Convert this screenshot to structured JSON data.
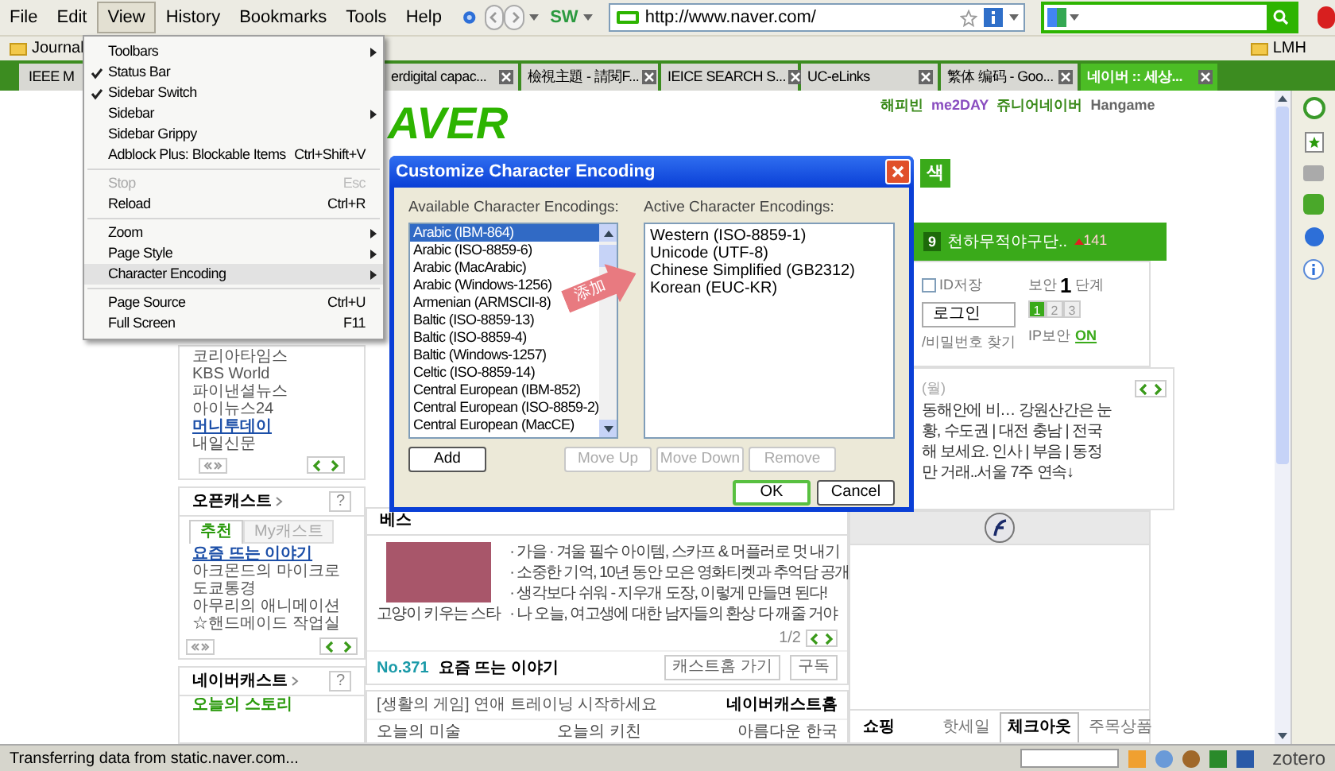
{
  "menu_bar": [
    {
      "label": "File",
      "selected": false
    },
    {
      "label": "Edit",
      "selected": false
    },
    {
      "label": "View",
      "selected": true
    },
    {
      "label": "History",
      "selected": false
    },
    {
      "label": "Bookmarks",
      "selected": false
    },
    {
      "label": "Tools",
      "selected": false
    },
    {
      "label": "Help",
      "selected": false
    }
  ],
  "navigation": {
    "search_engine": "SW",
    "url": "http://www.naver.com/"
  },
  "bookmarks_bar": [
    {
      "label": "Journal"
    },
    {
      "label": "LMH"
    }
  ],
  "tabs": [
    {
      "label": "IEEE M",
      "selected": false
    },
    {
      "label": "erdigital capac...",
      "selected": false
    },
    {
      "label": "檢視主題 - 請閱F...",
      "selected": false
    },
    {
      "label": "IEICE SEARCH S...",
      "selected": false
    },
    {
      "label": "UC-eLinks",
      "selected": false
    },
    {
      "label": "繁体 编码 - Goo...",
      "selected": false
    },
    {
      "label": "네이버 :: 세상...",
      "selected": true
    }
  ],
  "view_menu": [
    {
      "kind": "item",
      "label": "Toolbars",
      "submenu": true,
      "checked": false,
      "disabled": false,
      "selected": false
    },
    {
      "kind": "item",
      "label": "Status Bar",
      "submenu": false,
      "checked": true,
      "disabled": false,
      "selected": false
    },
    {
      "kind": "item",
      "label": "Sidebar Switch",
      "submenu": false,
      "checked": true,
      "disabled": false,
      "selected": false
    },
    {
      "kind": "item",
      "label": "Sidebar",
      "submenu": true,
      "checked": false,
      "disabled": false,
      "selected": false
    },
    {
      "kind": "item",
      "label": "Sidebar Grippy",
      "submenu": false,
      "checked": false,
      "disabled": false,
      "selected": false
    },
    {
      "kind": "item",
      "label": "Adblock Plus: Blockable Items",
      "shortcut": "Ctrl+Shift+V",
      "submenu": false,
      "checked": false,
      "disabled": false,
      "selected": false
    },
    {
      "kind": "separator"
    },
    {
      "kind": "item",
      "label": "Stop",
      "shortcut": "Esc",
      "submenu": false,
      "checked": false,
      "disabled": true,
      "selected": false
    },
    {
      "kind": "item",
      "label": "Reload",
      "shortcut": "Ctrl+R",
      "submenu": false,
      "checked": false,
      "disabled": false,
      "selected": false
    },
    {
      "kind": "separator"
    },
    {
      "kind": "item",
      "label": "Zoom",
      "submenu": true,
      "checked": false,
      "disabled": false,
      "selected": false
    },
    {
      "kind": "item",
      "label": "Page Style",
      "submenu": true,
      "checked": false,
      "disabled": false,
      "selected": false
    },
    {
      "kind": "item",
      "label": "Character Encoding",
      "submenu": true,
      "checked": false,
      "disabled": false,
      "selected": true
    },
    {
      "kind": "separator"
    },
    {
      "kind": "item",
      "label": "Page Source",
      "shortcut": "Ctrl+U",
      "submenu": false,
      "checked": false,
      "disabled": false,
      "selected": false
    },
    {
      "kind": "item",
      "label": "Full Screen",
      "shortcut": "F11",
      "submenu": false,
      "checked": false,
      "disabled": false,
      "selected": false
    }
  ],
  "dialog": {
    "title": "Customize Character Encoding",
    "available_label": "Available Character Encodings:",
    "available": [
      {
        "label": "Arabic (IBM-864)",
        "selected": true
      },
      {
        "label": "Arabic (ISO-8859-6)",
        "selected": false
      },
      {
        "label": "Arabic (MacArabic)",
        "selected": false
      },
      {
        "label": "Arabic (Windows-1256)",
        "selected": false
      },
      {
        "label": "Armenian (ARMSCII-8)",
        "selected": false
      },
      {
        "label": "Baltic (ISO-8859-13)",
        "selected": false
      },
      {
        "label": "Baltic (ISO-8859-4)",
        "selected": false
      },
      {
        "label": "Baltic (Windows-1257)",
        "selected": false
      },
      {
        "label": "Celtic (ISO-8859-14)",
        "selected": false
      },
      {
        "label": "Central European (IBM-852)",
        "selected": false
      },
      {
        "label": "Central European (ISO-8859-2)",
        "selected": false
      },
      {
        "label": "Central European (MacCE)",
        "selected": false
      }
    ],
    "active_label": "Active Character Encodings:",
    "active": [
      "Western (ISO-8859-1)",
      "Unicode (UTF-8)",
      "Chinese Simplified (GB2312)",
      "Korean (EUC-KR)"
    ],
    "add_button": {
      "label": "Add",
      "disabled": false
    },
    "order_buttons": [
      {
        "label": "Move Up",
        "disabled": true
      },
      {
        "label": "Move Down",
        "disabled": true
      },
      {
        "label": "Remove",
        "disabled": true
      }
    ],
    "ok_button": "OK",
    "cancel_button": "Cancel"
  },
  "annotation": {
    "text": "添加"
  },
  "page": {
    "portal_links": [
      "해피빈",
      "me2DAY",
      "쥬니어네이버",
      "Hangame"
    ],
    "logo": "AVER",
    "search_button": "색",
    "ranking": {
      "rank": "9",
      "text": "천하무적야구단..",
      "change": "141"
    },
    "login": {
      "save_id_label": "ID저장",
      "save_id_checked": false,
      "login_button": "로그인",
      "find_link": "/비밀번호 찾기",
      "security_prefix": "보안",
      "security_level": "1",
      "security_suffix": "단계",
      "levels": [
        {
          "label": "1",
          "selected": true
        },
        {
          "label": "2",
          "selected": false
        },
        {
          "label": "3",
          "selected": false
        }
      ],
      "ip_label": "IP보안",
      "ip_state": "ON"
    },
    "news": {
      "date": "(월)",
      "lines": [
        "동해안에 비… 강원산간은 눈",
        "황, 수도권 | 대전 충남 | 전국",
        "해 보세요. 인사 | 부음 | 동정",
        "만 거래..서울 7주 연속↓"
      ]
    },
    "shopping": {
      "title": "쇼핑",
      "tabs": [
        {
          "label": "핫세일",
          "selected": false
        },
        {
          "label": "체크아웃",
          "selected": true
        },
        {
          "label": "주목상품",
          "selected": false
        }
      ]
    },
    "press": [
      {
        "label": "코리아타임스",
        "selected": false
      },
      {
        "label": "KBS World",
        "selected": false
      },
      {
        "label": "파이낸셜뉴스",
        "selected": false
      },
      {
        "label": "아이뉴스24",
        "selected": false
      },
      {
        "label": "머니투데이",
        "selected": true
      },
      {
        "label": "내일신문",
        "selected": false
      }
    ],
    "open_cast": {
      "title": "오픈캐스트",
      "help": "?",
      "tabs": [
        {
          "label": "추천",
          "selected": true
        },
        {
          "label": "My캐스트",
          "selected": false
        }
      ],
      "featured": "요즘 뜨는 이야기",
      "items": [
        "아크몬드의 마이크로",
        "도쿄통경",
        "아무리의 애니메이션",
        "☆핸드메이드 작업실"
      ]
    },
    "best": {
      "header": "베스",
      "photo_caption": "고양이 키우는 스타",
      "bullets": [
        "· 가을 · 겨울 필수 아이템, 스카프 & 머플러로 멋 내기",
        "· 소중한 기억, 10년 동안 모은 영화티켓과 추억담 공개",
        "· 생각보다 쉬워 - 지우개 도장, 이렇게 만들면 된다!",
        "· 나 오늘, 여고생에 대한 남자들의 환상 다 깨줄 거야"
      ],
      "page": "1/2",
      "number": "No.371",
      "title": "요즘 뜨는 이야기",
      "buttons": [
        "캐스트홈 가기",
        "구독"
      ]
    },
    "naver_cast": {
      "title": "네이버캐스트",
      "help": "?",
      "story": "오늘의 스토리",
      "banner": "[생활의 게임] 연애 트레이닝 시작하세요",
      "home_link": "네이버캐스트홈",
      "columns": [
        "오늘의 미술",
        "오늘의 키친",
        "아름다운 한국"
      ]
    }
  },
  "status_bar": {
    "text": "Transferring data from static.naver.com...",
    "brand": "zotero"
  }
}
